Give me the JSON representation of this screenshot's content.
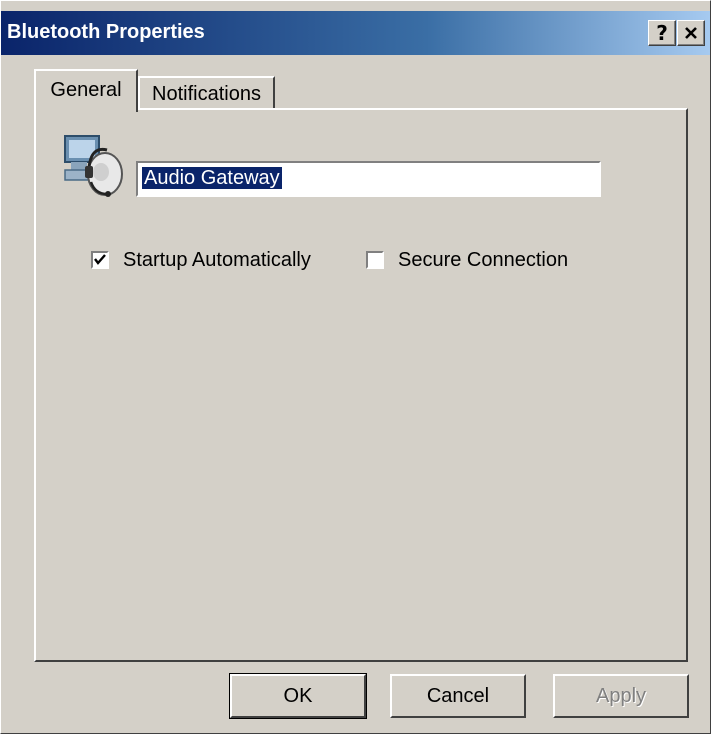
{
  "window": {
    "title": "Bluetooth Properties",
    "help_label": "?",
    "close_label": "✕"
  },
  "tabs": [
    {
      "label": "General",
      "selected": true
    },
    {
      "label": "Notifications",
      "selected": false
    }
  ],
  "general": {
    "device_icon": "headset-computer-icon",
    "service_name": "Audio Gateway",
    "startup_automatically": {
      "label": "Startup Automatically",
      "checked": true
    },
    "secure_connection": {
      "label": "Secure Connection",
      "checked": false
    }
  },
  "buttons": {
    "ok": "OK",
    "cancel": "Cancel",
    "apply": "Apply"
  },
  "colors": {
    "title_gradient_start": "#0a246a",
    "title_gradient_end": "#a6caf0",
    "face": "#d4d0c8",
    "selection": "#0a246a"
  }
}
